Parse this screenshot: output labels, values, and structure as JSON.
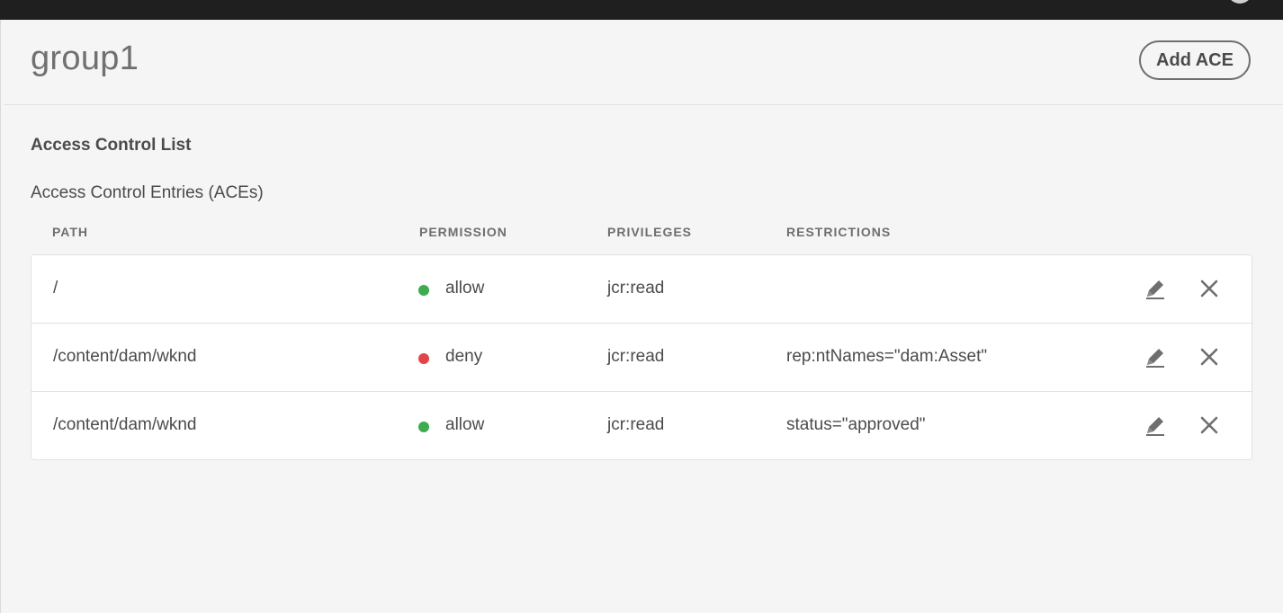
{
  "header": {
    "title": "group1",
    "add_button_label": "Add ACE"
  },
  "acl": {
    "section_title": "Access Control List",
    "entries_title": "Access Control Entries (ACEs)",
    "columns": {
      "path": "PATH",
      "permission": "PERMISSION",
      "privileges": "PRIVILEGES",
      "restrictions": "RESTRICTIONS"
    },
    "rows": [
      {
        "path": "/",
        "permission": "allow",
        "privileges": "jcr:read",
        "restrictions": ""
      },
      {
        "path": "/content/dam/wknd",
        "permission": "deny",
        "privileges": "jcr:read",
        "restrictions": "rep:ntNames=\"dam:Asset\""
      },
      {
        "path": "/content/dam/wknd",
        "permission": "allow",
        "privileges": "jcr:read",
        "restrictions": "status=\"approved\""
      }
    ]
  },
  "colors": {
    "allow": "#3dab4e",
    "deny": "#e0454a",
    "icon": "#6e6e6e",
    "top_bar": "#1f1f1f"
  },
  "icons": {
    "edit": "pencil-icon",
    "delete": "close-icon"
  }
}
